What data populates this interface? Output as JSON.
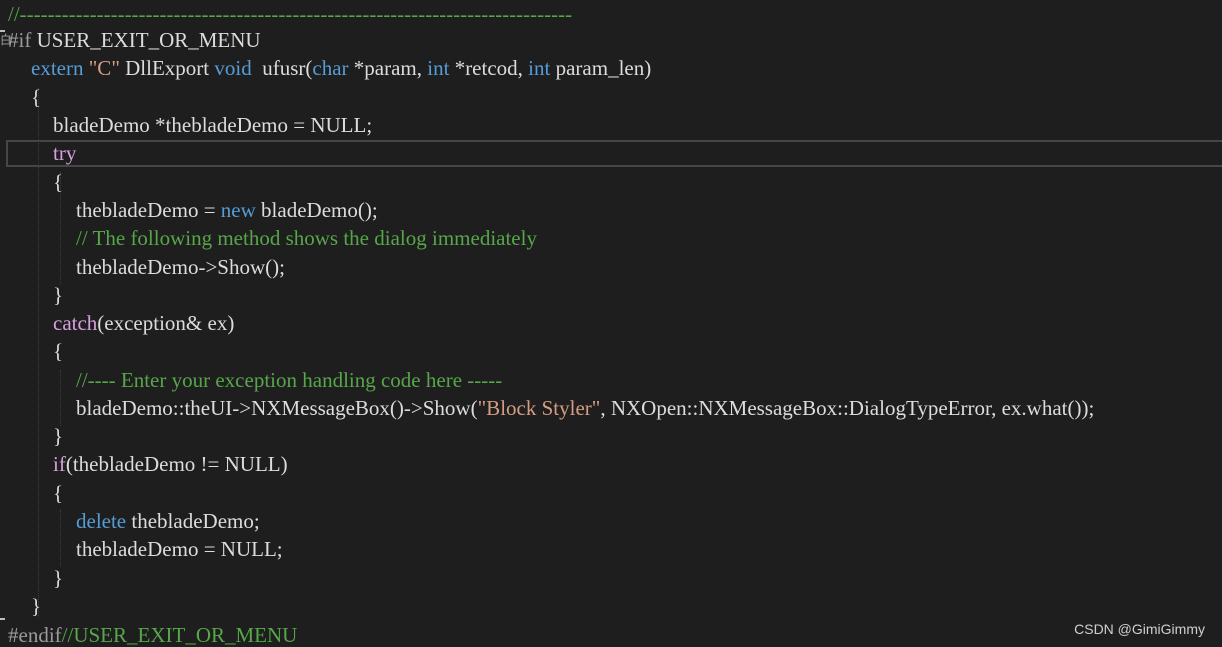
{
  "editor": {
    "lines": [
      {
        "segments": [
          {
            "t": "//-------------------------------------------------------------------------------",
            "c": "c"
          }
        ]
      },
      {
        "segments": [
          {
            "t": "#if",
            "c": "pp"
          },
          {
            "t": " USER_EXIT_OR_MENU",
            "c": "d"
          }
        ]
      },
      {
        "segments": [
          {
            "t": "extern",
            "c": "k"
          },
          {
            "t": " ",
            "c": "d"
          },
          {
            "t": "\"C\"",
            "c": "s"
          },
          {
            "t": " DllExport ",
            "c": "d"
          },
          {
            "t": "void",
            "c": "k"
          },
          {
            "t": "  ufusr(",
            "c": "d"
          },
          {
            "t": "char",
            "c": "k"
          },
          {
            "t": " *param, ",
            "c": "d"
          },
          {
            "t": "int",
            "c": "k"
          },
          {
            "t": " *retcod, ",
            "c": "d"
          },
          {
            "t": "int",
            "c": "k"
          },
          {
            "t": " param_len)",
            "c": "d"
          }
        ]
      },
      {
        "segments": [
          {
            "t": "{",
            "c": "d"
          }
        ]
      },
      {
        "segments": [
          {
            "t": "bladeDemo *thebladeDemo = NULL;",
            "c": "d"
          }
        ]
      },
      {
        "segments": [
          {
            "t": "try",
            "c": "ctl"
          }
        ]
      },
      {
        "segments": [
          {
            "t": "{",
            "c": "d"
          }
        ]
      },
      {
        "segments": [
          {
            "t": "thebladeDemo = ",
            "c": "d"
          },
          {
            "t": "new",
            "c": "k"
          },
          {
            "t": " bladeDemo();",
            "c": "d"
          }
        ]
      },
      {
        "segments": [
          {
            "t": "// The following method shows the dialog immediately",
            "c": "c"
          }
        ]
      },
      {
        "segments": [
          {
            "t": "thebladeDemo->Show();",
            "c": "d"
          }
        ]
      },
      {
        "segments": [
          {
            "t": "}",
            "c": "d"
          }
        ]
      },
      {
        "segments": [
          {
            "t": "catch",
            "c": "ctl"
          },
          {
            "t": "(exception& ex)",
            "c": "d"
          }
        ]
      },
      {
        "segments": [
          {
            "t": "{",
            "c": "d"
          }
        ]
      },
      {
        "segments": [
          {
            "t": "//---- Enter your exception handling code here -----",
            "c": "c"
          }
        ]
      },
      {
        "segments": [
          {
            "t": "bladeDemo::theUI->NXMessageBox()->Show(",
            "c": "d"
          },
          {
            "t": "\"Block Styler\"",
            "c": "s"
          },
          {
            "t": ", NXOpen::NXMessageBox::DialogTypeError, ex.what());",
            "c": "d"
          }
        ]
      },
      {
        "segments": [
          {
            "t": "}",
            "c": "d"
          }
        ]
      },
      {
        "segments": [
          {
            "t": "if",
            "c": "ctl"
          },
          {
            "t": "(thebladeDemo != NULL)",
            "c": "d"
          }
        ]
      },
      {
        "segments": [
          {
            "t": "{",
            "c": "d"
          }
        ]
      },
      {
        "segments": [
          {
            "t": "delete",
            "c": "k"
          },
          {
            "t": " thebladeDemo;",
            "c": "d"
          }
        ]
      },
      {
        "segments": [
          {
            "t": "thebladeDemo = NULL;",
            "c": "d"
          }
        ]
      },
      {
        "segments": [
          {
            "t": "}",
            "c": "d"
          }
        ]
      },
      {
        "segments": [
          {
            "t": "}",
            "c": "d"
          }
        ]
      },
      {
        "segments": [
          {
            "t": "#endif",
            "c": "pp"
          },
          {
            "t": "//USER_EXIT_OR_MENU",
            "c": "c"
          }
        ]
      }
    ]
  },
  "gutter": {
    "fold_glyph": "白"
  },
  "watermark": "CSDN @GimiGimmy",
  "colors": {
    "background": "#1e1e1e",
    "keyword": "#569cd6",
    "control": "#d8a0df",
    "preprocessor": "#9b9b9b",
    "string": "#d69d85",
    "comment": "#57a64a",
    "default": "#dcdcdc"
  }
}
